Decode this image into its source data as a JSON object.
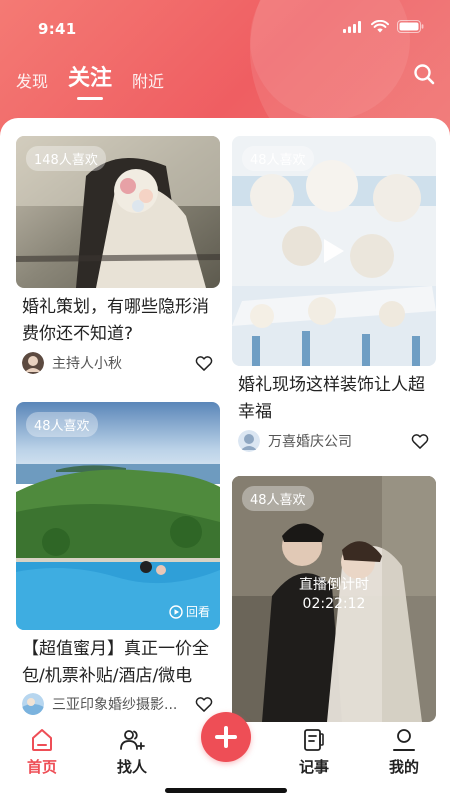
{
  "status_bar": {
    "time": "9:41"
  },
  "tabs": [
    {
      "label": "发现",
      "active": false
    },
    {
      "label": "关注",
      "active": true
    },
    {
      "label": "附近",
      "active": false
    }
  ],
  "accent_color": "#ee4e56",
  "cards": [
    {
      "likes": "148人喜欢",
      "title": "婚礼策划，有哪些隐形消费你还不知道?",
      "author": "主持人小秋",
      "icons": [
        "heart-icon"
      ]
    },
    {
      "likes": "48人喜欢",
      "title": "婚礼现场这样装饰让人超幸福",
      "author": "万喜婚庆公司",
      "icons": [
        "play-icon",
        "heart-icon"
      ]
    },
    {
      "likes": "48人喜欢",
      "title": "【超值蜜月】真正一价全包/机票补贴/酒店/微电",
      "author": "三亚印象婚纱摄影...",
      "replay_label": "回看",
      "icons": [
        "replay-icon",
        "heart-icon"
      ]
    },
    {
      "likes": "48人喜欢",
      "live_label": "直播倒计时",
      "countdown": "02:22:12"
    }
  ],
  "bottom_nav": [
    {
      "label": "首页",
      "icon": "home-icon",
      "active": true
    },
    {
      "label": "找人",
      "icon": "people-icon",
      "active": false
    },
    {
      "label": "记事",
      "icon": "notebook-icon",
      "active": false
    },
    {
      "label": "我的",
      "icon": "profile-icon",
      "active": false
    }
  ]
}
